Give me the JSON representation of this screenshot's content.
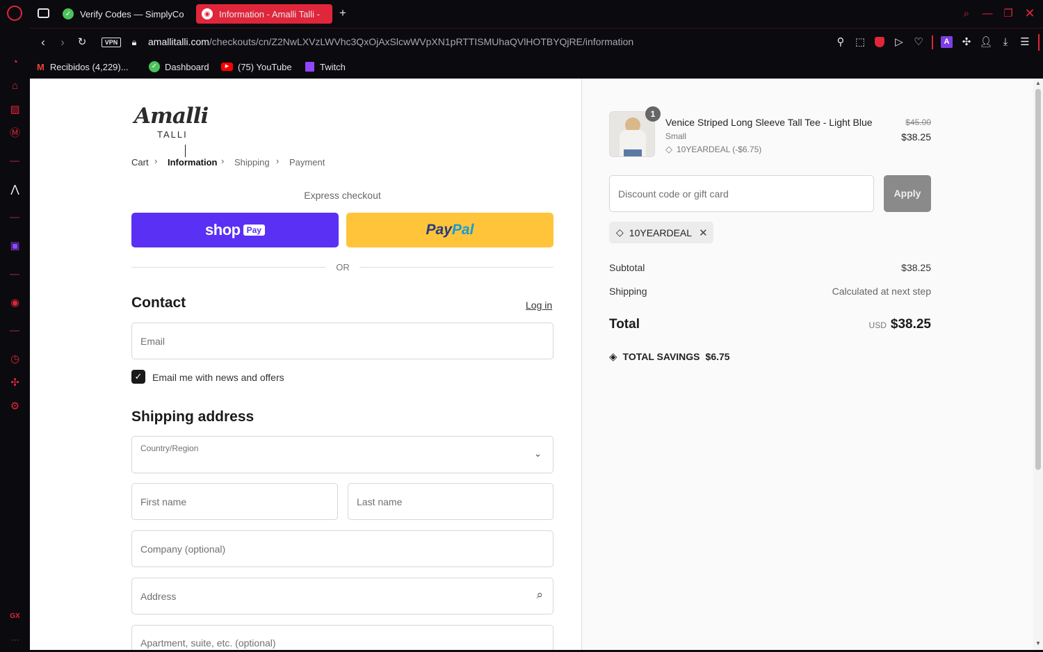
{
  "browser": {
    "tabs": [
      {
        "title": "Verify Codes — SimplyCo",
        "active": false
      },
      {
        "title": "Information - Amalli Talli -",
        "active": true
      }
    ],
    "new_tab": "+",
    "url_domain": "amallitalli.com",
    "url_path": "/checkouts/cn/Z2NwLXVzLWVhc3QxOjAxSlcwWVpXN1pRTTISMUhaQVlHOTBYQjRE/information",
    "vpn_label": "VPN",
    "bookmarks": [
      {
        "label": "Recibidos (4,229)..."
      },
      {
        "label": "Dashboard"
      },
      {
        "label": "(75) YouTube"
      },
      {
        "label": "Twitch"
      }
    ],
    "sidebar_gx": "GX",
    "sidebar_more": "···"
  },
  "checkout": {
    "logo_text": "Amalli",
    "logo_sub": "TALLI",
    "breadcrumbs": [
      "Cart",
      "Information",
      "Shipping",
      "Payment"
    ],
    "express_checkout": "Express checkout",
    "shop_pay": "shop",
    "shop_pay_badge": "Pay",
    "paypal_pay": "Pay",
    "paypal_pal": "Pal",
    "or": "OR",
    "contact_title": "Contact",
    "login": "Log in",
    "email_placeholder": "Email",
    "newsletter_label": "Email me with news and offers",
    "shipping_title": "Shipping address",
    "country_label": "Country/Region",
    "first_name": "First name",
    "last_name": "Last name",
    "company": "Company (optional)",
    "address": "Address",
    "apartment": "Apartment, suite, etc. (optional)"
  },
  "summary": {
    "item": {
      "quantity": "1",
      "name": "Venice Striped Long Sleeve Tall Tee - Light Blue",
      "variant": "Small",
      "discount": "10YEARDEAL (-$6.75)",
      "original_price": "$45.00",
      "price": "$38.25"
    },
    "discount_placeholder": "Discount code or gift card",
    "apply": "Apply",
    "applied_code": "10YEARDEAL",
    "subtotal_label": "Subtotal",
    "subtotal_value": "$38.25",
    "shipping_label": "Shipping",
    "shipping_value": "Calculated at next step",
    "total_label": "Total",
    "currency": "USD",
    "total_value": "$38.25",
    "savings_label": "TOTAL SAVINGS",
    "savings_value": "$6.75"
  },
  "colors": {
    "opera_red": "#e0263a",
    "shop_pay": "#5a31f4",
    "paypal": "#ffc439",
    "paypal_dark": "#253b80",
    "paypal_light": "#179bd7"
  }
}
